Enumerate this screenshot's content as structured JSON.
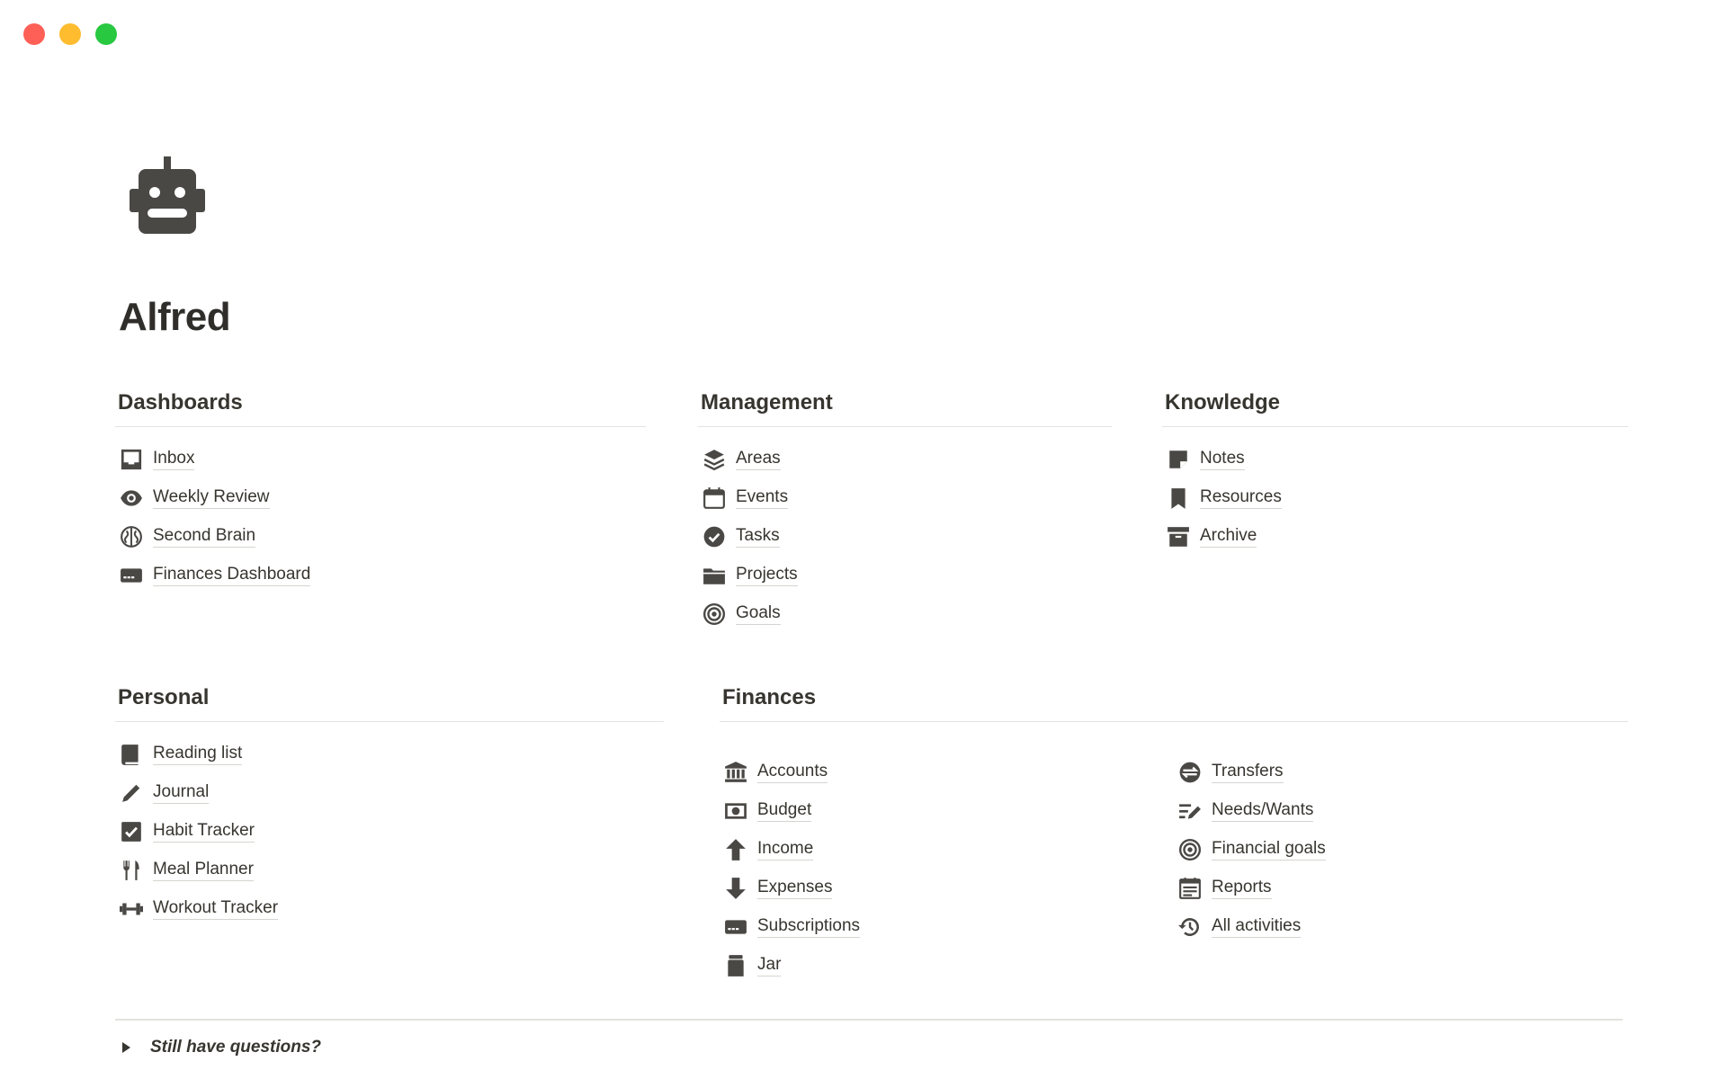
{
  "window": {
    "controls": [
      "close",
      "minimize",
      "maximize"
    ]
  },
  "page": {
    "icon": "robot-icon",
    "title": "Alfred"
  },
  "dashboards": {
    "heading": "Dashboards",
    "items": [
      {
        "label": "Inbox",
        "icon": "inbox-icon"
      },
      {
        "label": "Weekly Review",
        "icon": "eye-icon"
      },
      {
        "label": "Second Brain",
        "icon": "brain-icon"
      },
      {
        "label": "Finances Dashboard",
        "icon": "card-icon"
      }
    ]
  },
  "management": {
    "heading": "Management",
    "items": [
      {
        "label": "Areas",
        "icon": "layers-icon"
      },
      {
        "label": "Events",
        "icon": "calendar-icon"
      },
      {
        "label": "Tasks",
        "icon": "check-circle-icon"
      },
      {
        "label": "Projects",
        "icon": "folder-icon"
      },
      {
        "label": "Goals",
        "icon": "target-icon"
      }
    ]
  },
  "knowledge": {
    "heading": "Knowledge",
    "items": [
      {
        "label": "Notes",
        "icon": "note-icon"
      },
      {
        "label": "Resources",
        "icon": "bookmark-icon"
      },
      {
        "label": "Archive",
        "icon": "archive-icon"
      }
    ]
  },
  "personal": {
    "heading": "Personal",
    "items": [
      {
        "label": "Reading list",
        "icon": "book-icon"
      },
      {
        "label": "Journal",
        "icon": "pencil-icon"
      },
      {
        "label": "Habit Tracker",
        "icon": "checkbox-icon"
      },
      {
        "label": "Meal Planner",
        "icon": "utensils-icon"
      },
      {
        "label": "Workout Tracker",
        "icon": "dumbbell-icon"
      }
    ]
  },
  "finances": {
    "heading": "Finances",
    "left_items": [
      {
        "label": "Accounts",
        "icon": "bank-icon"
      },
      {
        "label": "Budget",
        "icon": "money-icon"
      },
      {
        "label": "Income",
        "icon": "arrow-up-icon"
      },
      {
        "label": "Expenses",
        "icon": "arrow-down-icon"
      },
      {
        "label": "Subscriptions",
        "icon": "card-icon"
      },
      {
        "label": "Jar",
        "icon": "jar-icon"
      }
    ],
    "right_items": [
      {
        "label": "Transfers",
        "icon": "transfer-icon"
      },
      {
        "label": "Needs/Wants",
        "icon": "list-edit-icon"
      },
      {
        "label": "Financial goals",
        "icon": "target-icon"
      },
      {
        "label": "Reports",
        "icon": "report-icon"
      },
      {
        "label": "All activities",
        "icon": "history-icon"
      }
    ]
  },
  "footer": {
    "toggle_label": "Still have questions?"
  },
  "colors": {
    "icon": "#4a4845",
    "text": "#37352f",
    "divider": "#e3e2df"
  }
}
